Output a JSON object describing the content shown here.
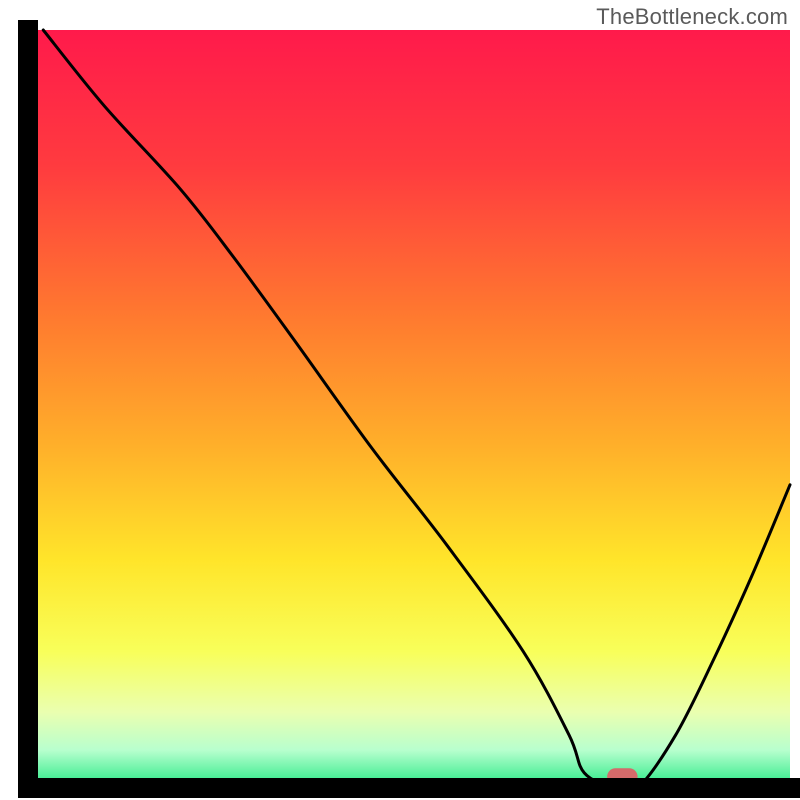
{
  "watermark": "TheBottleneck.com",
  "chart_data": {
    "type": "line",
    "title": "",
    "xlabel": "",
    "ylabel": "",
    "xlim": [
      0,
      100
    ],
    "ylim": [
      0,
      100
    ],
    "grid": false,
    "legend": false,
    "series": [
      {
        "name": "bottleneck-curve",
        "x": [
          2,
          10,
          20,
          27,
          35,
          45,
          55,
          65,
          71,
          73,
          77,
          80,
          85,
          90,
          95,
          100
        ],
        "y": [
          100,
          90,
          79,
          70,
          59,
          45,
          32,
          18,
          7,
          2,
          0,
          0,
          7,
          17,
          28,
          40
        ]
      }
    ],
    "marker": {
      "name": "optimal-point",
      "x": 78,
      "y": 1.5,
      "color": "#d46a6a",
      "width": 4,
      "height": 2.2
    },
    "gradient_stops": [
      {
        "offset": 0.0,
        "color": "#ff1a4b"
      },
      {
        "offset": 0.18,
        "color": "#ff3b3f"
      },
      {
        "offset": 0.38,
        "color": "#ff7a2f"
      },
      {
        "offset": 0.55,
        "color": "#ffb02a"
      },
      {
        "offset": 0.7,
        "color": "#ffe52a"
      },
      {
        "offset": 0.82,
        "color": "#f8ff5a"
      },
      {
        "offset": 0.9,
        "color": "#eaffb0"
      },
      {
        "offset": 0.95,
        "color": "#b8ffce"
      },
      {
        "offset": 1.0,
        "color": "#23e884"
      }
    ],
    "axis_color": "#000000",
    "curve_color": "#000000",
    "curve_width": 3
  }
}
